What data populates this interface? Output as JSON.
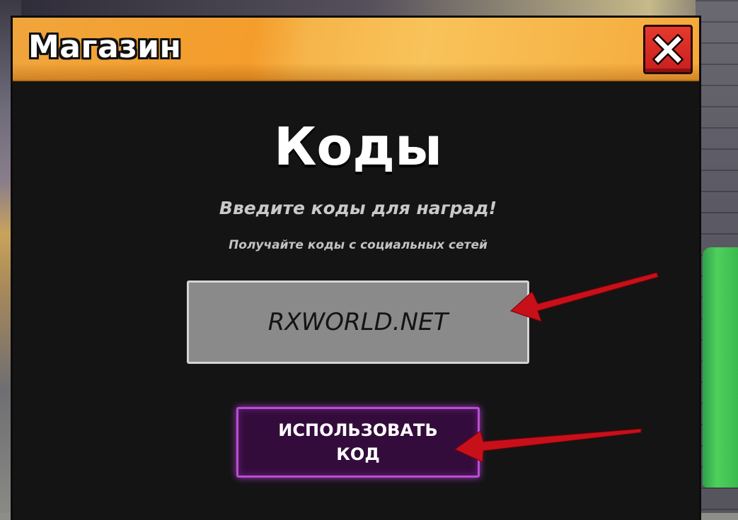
{
  "window": {
    "title": "Магазин",
    "close_icon": "close-icon"
  },
  "codes": {
    "heading": "Коды",
    "subtitle": "Введите коды для наград!",
    "note": "Получайте коды с социальных сетей",
    "input_value": "RXWORLD.NET",
    "redeem_label": "ИСПОЛЬЗОВАТЬ КОД"
  },
  "colors": {
    "header": "#f49d2c",
    "panel": "#141414",
    "close_button": "#d82a24",
    "input_background": "#8a8a8a",
    "redeem_button": "#340c3c",
    "redeem_border": "#b84fd0",
    "annotation_arrow": "#c8101a"
  }
}
